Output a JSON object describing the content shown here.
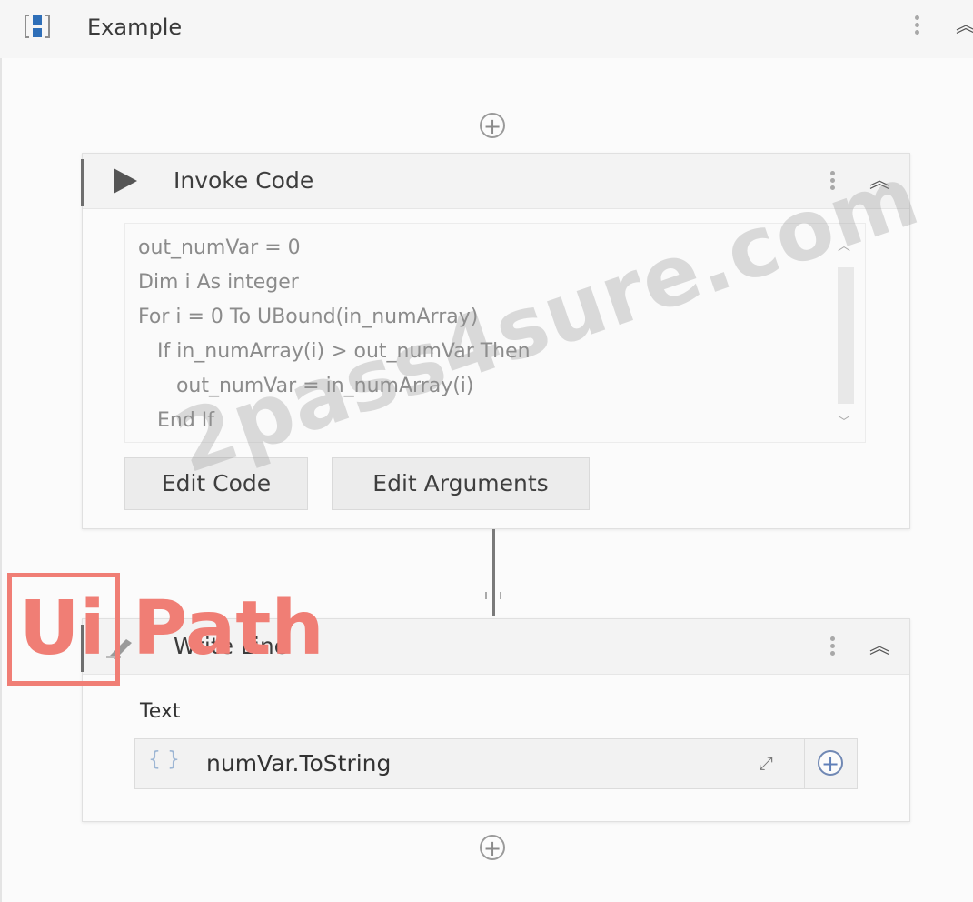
{
  "sequence": {
    "title": "Example"
  },
  "invoke_code": {
    "title": "Invoke Code",
    "code_lines": [
      "out_numVar = 0",
      "Dim i As integer",
      "For i = 0 To UBound(in_numArray)",
      "   If in_numArray(i) > out_numVar Then",
      "      out_numVar = in_numArray(i)",
      "   End If"
    ],
    "edit_code_label": "Edit Code",
    "edit_arguments_label": "Edit Arguments"
  },
  "write_line": {
    "title": "Write Line",
    "text_label": "Text",
    "text_value": "numVar.ToString"
  },
  "watermark": {
    "text": "2pass4sure.com"
  },
  "logo": {
    "ui": "Ui",
    "path": "Path"
  },
  "colors": {
    "logo": "#f07e75",
    "play_icon": "#555555",
    "accent_blue": "#5f7fb8"
  }
}
